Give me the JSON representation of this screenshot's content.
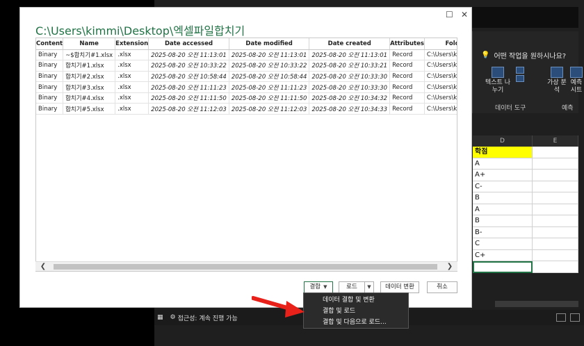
{
  "dialog": {
    "title": "C:\\Users\\kimmi\\Desktop\\엑셀파일합치기",
    "columns": [
      "Content",
      "Name",
      "Extension",
      "Date accessed",
      "Date modified",
      "Date created",
      "Attributes",
      "Folde"
    ],
    "rows": [
      [
        "Binary",
        "~$합치기#1.xlsx",
        ".xlsx",
        "2025-08-20 오전 11:13:01",
        "2025-08-20 오전 11:13:01",
        "2025-08-20 오전 11:13:01",
        "Record",
        "C:\\Users\\kimmi\\De"
      ],
      [
        "Binary",
        "합치기#1.xlsx",
        ".xlsx",
        "2025-08-20 오전 10:33:22",
        "2025-08-20 오전 10:33:22",
        "2025-08-20 오전 10:33:21",
        "Record",
        "C:\\Users\\kimmi\\De"
      ],
      [
        "Binary",
        "합치기#2.xlsx",
        ".xlsx",
        "2025-08-20 오전 10:58:44",
        "2025-08-20 오전 10:58:44",
        "2025-08-20 오전 10:33:30",
        "Record",
        "C:\\Users\\kimmi\\De"
      ],
      [
        "Binary",
        "합치기#3.xlsx",
        ".xlsx",
        "2025-08-20 오전 11:11:23",
        "2025-08-20 오전 11:11:23",
        "2025-08-20 오전 10:33:30",
        "Record",
        "C:\\Users\\kimmi\\De"
      ],
      [
        "Binary",
        "합치기#4.xlsx",
        ".xlsx",
        "2025-08-20 오전 11:11:50",
        "2025-08-20 오전 11:11:50",
        "2025-08-20 오전 10:34:32",
        "Record",
        "C:\\Users\\kimmi\\De"
      ],
      [
        "Binary",
        "합치기#5.xlsx",
        ".xlsx",
        "2025-08-20 오전 11:12:03",
        "2025-08-20 오전 11:12:03",
        "2025-08-20 오전 10:34:33",
        "Record",
        "C:\\Users\\kimmi\\De"
      ]
    ],
    "buttons": {
      "combine": "결합",
      "load": "로드",
      "transform": "데이터 변환",
      "cancel": "취소"
    },
    "combine_menu": [
      "데이터 결합 및 변환",
      "결합 및 로드",
      "결합 및 다음으로 로드..."
    ]
  },
  "excel": {
    "tell_me": "어떤 작업을 원하시나요?",
    "ribbon": {
      "text_to_columns": "텍스트 나누기",
      "what_if": "가상 분석",
      "forecast_sheet": "예측 시트",
      "group_data_tools": "데이터 도구",
      "group_forecast": "예측"
    },
    "col_d": "D",
    "col_e": "E",
    "cells": [
      "학점",
      "A",
      "A+",
      "C-",
      "B",
      "A",
      "B",
      "B-",
      "C",
      "C+",
      ""
    ],
    "status_accessibility": "접근성: 계속 진행 가능"
  },
  "colors": {
    "accent": "#217346",
    "arrow": "#e8221b",
    "highlight": "#ffff00"
  }
}
